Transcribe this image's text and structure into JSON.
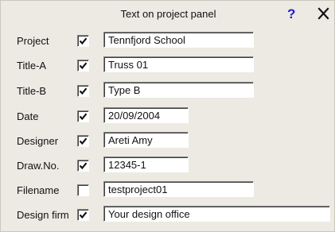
{
  "panel": {
    "title": "Text on project panel",
    "help_label": "?"
  },
  "rows": [
    {
      "label": "Project",
      "checked": true,
      "value": "Tennfjord School"
    },
    {
      "label": "Title-A",
      "checked": true,
      "value": "Truss 01"
    },
    {
      "label": "Title-B",
      "checked": true,
      "value": "Type B"
    },
    {
      "label": "Date",
      "checked": true,
      "value": "20/09/2004"
    },
    {
      "label": "Designer",
      "checked": true,
      "value": "Areti Amy"
    },
    {
      "label": "Draw.No.",
      "checked": true,
      "value": "12345-1"
    },
    {
      "label": "Filename",
      "checked": false,
      "value": "testproject01"
    },
    {
      "label": "Design firm",
      "checked": true,
      "value": "Your design office"
    }
  ],
  "colors": {
    "panel_bg": "#eceae3",
    "help_icon": "#1a20c8"
  },
  "icons": [
    "help-icon",
    "close-icon",
    "check-icon"
  ]
}
